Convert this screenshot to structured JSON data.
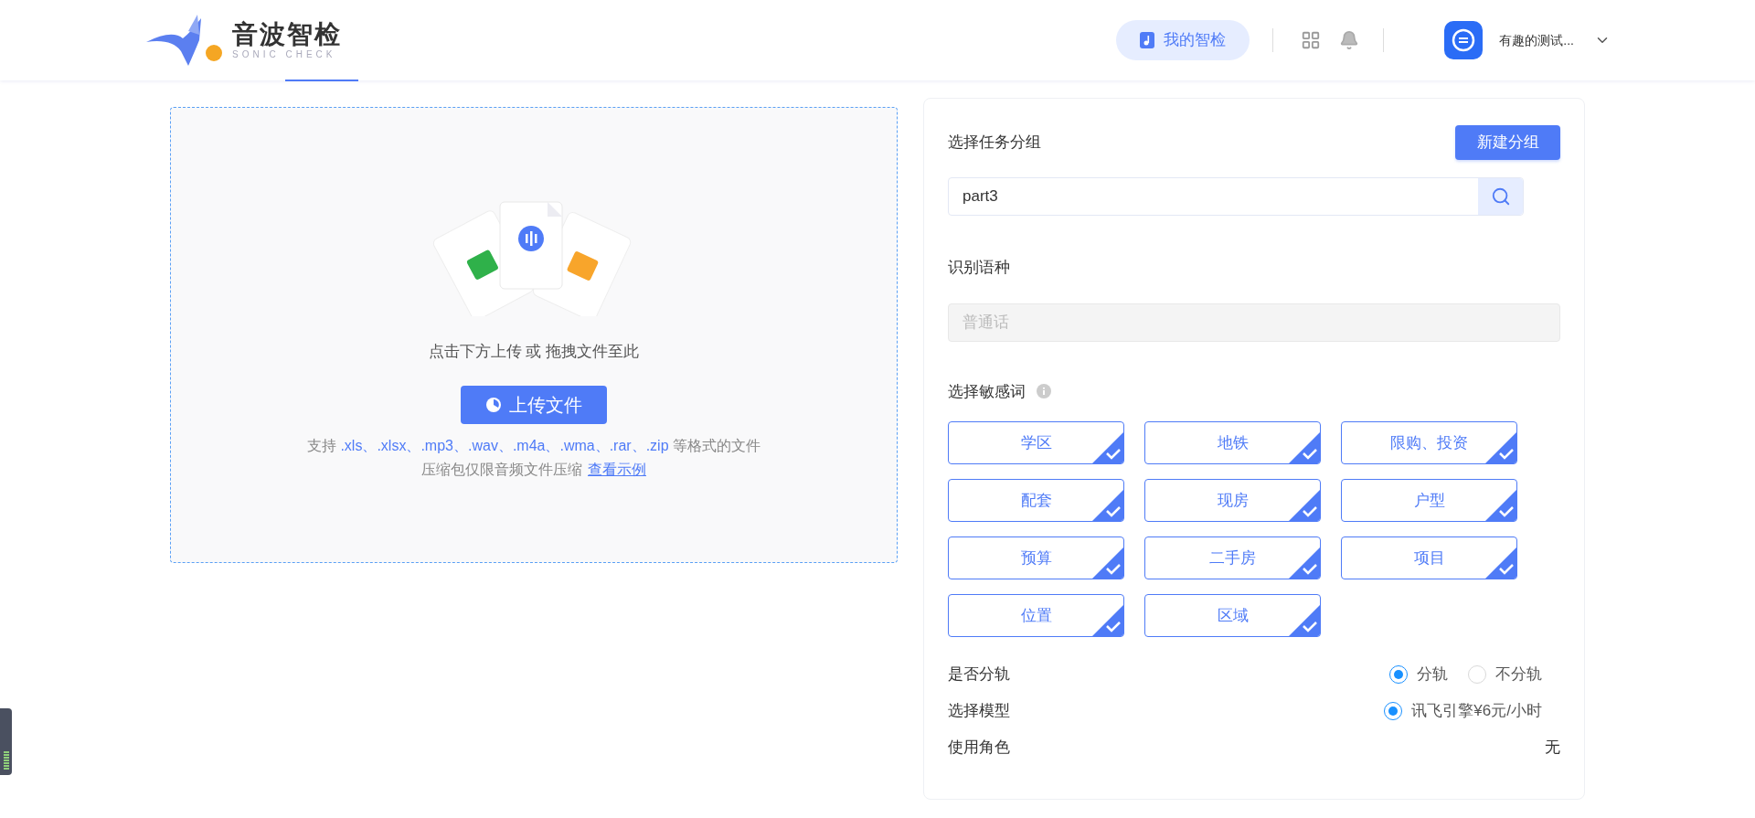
{
  "header": {
    "logo": {
      "name": "音波智检",
      "subtitle": "SONIC CHECK"
    },
    "my_button": "我的智检",
    "user": {
      "name": "有趣的测试..."
    }
  },
  "upload": {
    "hint": "点击下方上传 或 拖拽文件至此",
    "button": "上传文件",
    "formats": {
      "prefix": "支持",
      "list": ".xls、.xlsx、.mp3、.wav、.m4a、.wma、.rar、.zip",
      "suffix": "等格式的文件"
    },
    "note": "压缩包仅限音频文件压缩",
    "example_link": "查看示例"
  },
  "panel": {
    "group_label": "选择任务分组",
    "new_group_button": "新建分组",
    "group_value": "part3",
    "language_label": "识别语种",
    "language_placeholder": "普通话",
    "sensitive_label": "选择敏感词",
    "tags": [
      {
        "label": "学区",
        "selected": true
      },
      {
        "label": "地铁",
        "selected": true
      },
      {
        "label": "限购、投资",
        "selected": true
      },
      {
        "label": "配套",
        "selected": true
      },
      {
        "label": "现房",
        "selected": true
      },
      {
        "label": "户型",
        "selected": true
      },
      {
        "label": "预算",
        "selected": true
      },
      {
        "label": "二手房",
        "selected": true
      },
      {
        "label": "项目",
        "selected": true
      },
      {
        "label": "位置",
        "selected": true
      },
      {
        "label": "区域",
        "selected": true
      }
    ],
    "track": {
      "label": "是否分轨",
      "options": [
        {
          "label": "分轨",
          "selected": true
        },
        {
          "label": "不分轨",
          "selected": false
        }
      ]
    },
    "model": {
      "label": "选择模型",
      "options": [
        {
          "label": "讯飞引擎¥6元/小时",
          "selected": true
        }
      ]
    },
    "role": {
      "label": "使用角色",
      "value": "无"
    }
  }
}
